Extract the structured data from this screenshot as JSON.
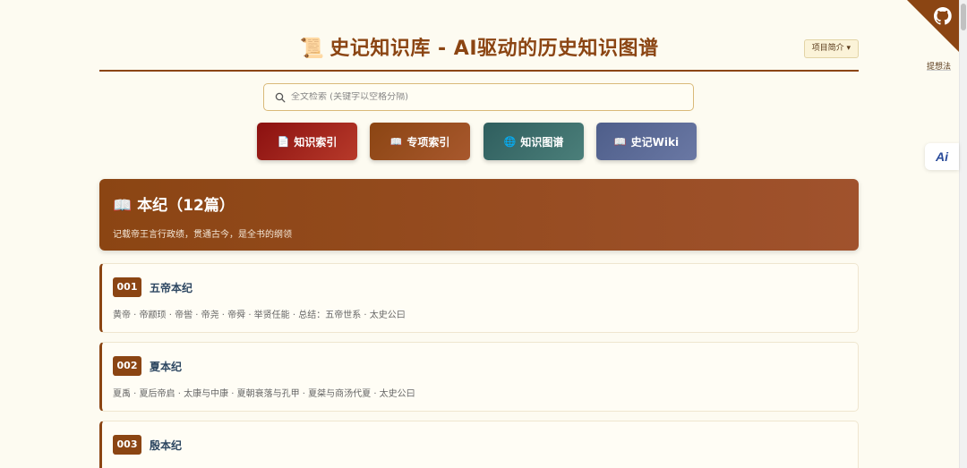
{
  "header": {
    "title": "史记知识库 - AI驱动的历史知识图谱",
    "intro_button": "项目简介 ▾"
  },
  "side": {
    "idea_link": "提想法",
    "ai_badge": "Ai"
  },
  "search": {
    "placeholder": "全文检索 (关键字以空格分隔)"
  },
  "nav": [
    {
      "label": "知识索引"
    },
    {
      "label": "专项索引"
    },
    {
      "label": "知识图谱"
    },
    {
      "label": "史记Wiki"
    }
  ],
  "section": {
    "title": "本纪（12篇）",
    "description": "记载帝王言行政绩，贯通古今，是全书的纲领"
  },
  "chapters": [
    {
      "number": "001",
      "title": "五帝本纪",
      "summary": "黄帝 · 帝颛顼 · 帝喾 · 帝尧 · 帝舜 · 举贤任能 · 总结：五帝世系 · 太史公曰"
    },
    {
      "number": "002",
      "title": "夏本纪",
      "summary": "夏禹 · 夏后帝启 · 太康与中康 · 夏朝衰落与孔甲 · 夏桀与商汤代夏 · 太史公曰"
    },
    {
      "number": "003",
      "title": "殷本纪",
      "summary": ""
    }
  ],
  "colors": {
    "brand": "#8b4513",
    "background": "#fdfbf1",
    "nav_index": "#8b1010",
    "nav_special": "#8b4513",
    "nav_graph": "#2f5e5e",
    "nav_wiki": "#4e5e8a"
  }
}
